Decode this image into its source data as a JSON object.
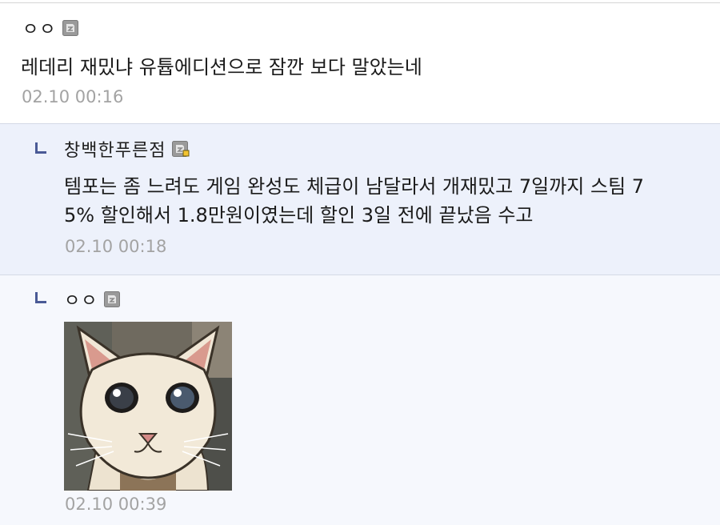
{
  "comments": [
    {
      "nickname": "ㅇㅇ",
      "icon": "gallog-icon",
      "text": "레데리 재밌냐 유튭에디션으로 잠깐 보다 말았는네",
      "time": "02.10 00:16",
      "is_reply": false
    },
    {
      "nickname": "창백한푸른점",
      "icon": "gallog-fixed-icon",
      "text_lines": [
        "템포는 좀 느려도 게임 완성도 체급이 남달라서 개재밌고 7일까지 스팀 7",
        "5% 할인해서 1.8만원이였는데 할인 3일 전에 끝났음 수고"
      ],
      "time": "02.10 00:18",
      "is_reply": true
    },
    {
      "nickname": "ㅇㅇ",
      "icon": "gallog-icon",
      "image": "cat-sticker",
      "time": "02.10 00:39",
      "is_reply": true
    }
  ],
  "colors": {
    "reply_bg": "#edf1fb",
    "reply_bg_2": "#f6f8fd",
    "reply_mark": "#4a5a96",
    "time": "#a3a3a3"
  }
}
